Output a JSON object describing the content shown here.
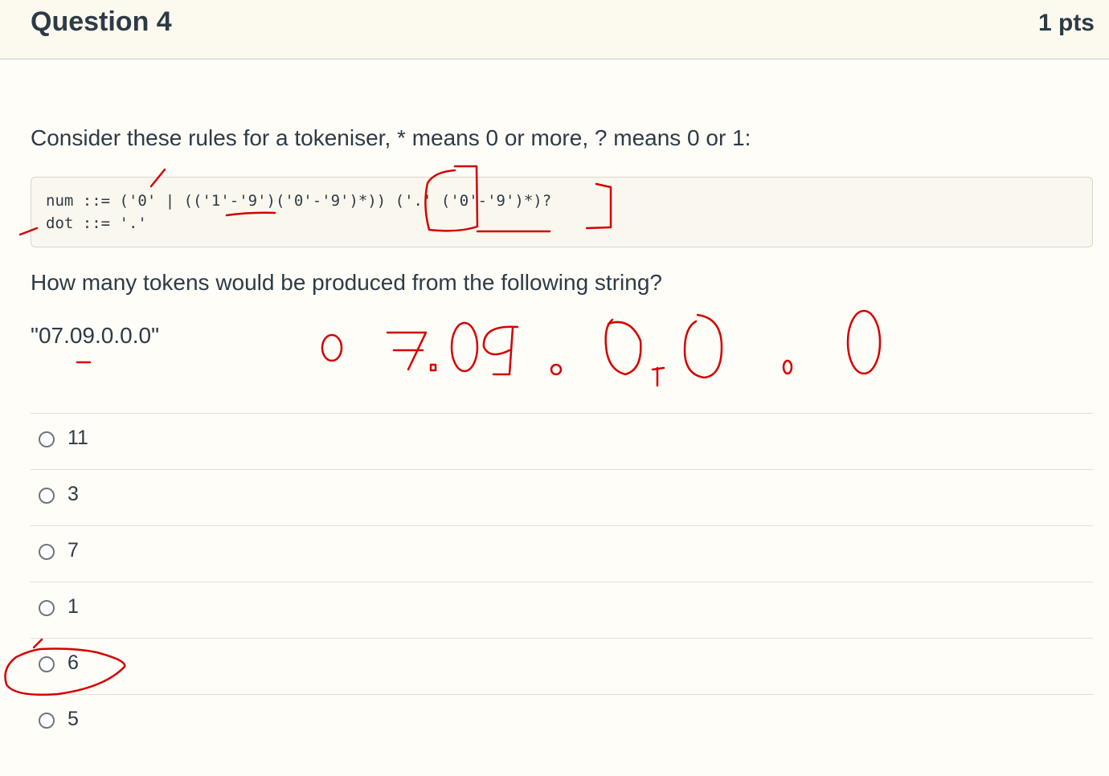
{
  "question": {
    "title": "Question 4",
    "points": "1 pts",
    "prompt_intro": "Consider these rules for a tokeniser, * means 0 or more, ? means 0 or 1:",
    "code_lines": [
      "num ::= ('0' | (('1'-'9')('0'-'9')*)) ('.' ('0'-'9')*)?",
      "dot ::= '.'"
    ],
    "prompt_question": "How many tokens would be produced from the following string?",
    "input_string": "\"07.09.0.0.0\""
  },
  "answers": [
    {
      "label": "11"
    },
    {
      "label": "3"
    },
    {
      "label": "7"
    },
    {
      "label": "1"
    },
    {
      "label": "6"
    },
    {
      "label": "5"
    }
  ],
  "colors": {
    "annotation_ink": "#d40000",
    "text": "#2d3b45",
    "header_bg": "#fcf9ef"
  }
}
